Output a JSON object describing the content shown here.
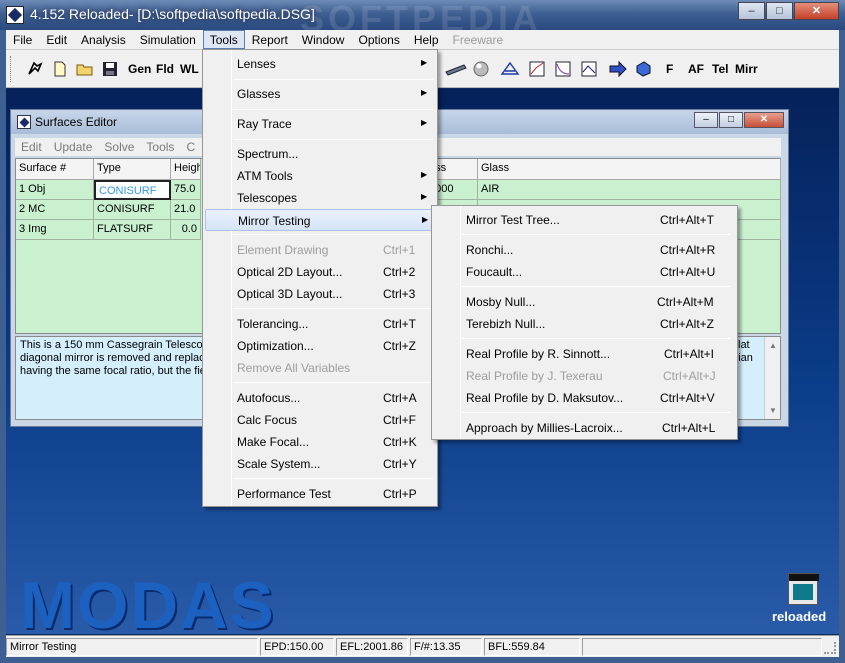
{
  "window": {
    "title": "4.152 Reloaded- [D:\\softpedia\\softpedia.DSG]",
    "watermark": "SOFTPEDIA",
    "minimize": "–",
    "maximize": "□",
    "close": "✕"
  },
  "menubar": [
    "File",
    "Edit",
    "Analysis",
    "Simulation",
    "Tools",
    "Report",
    "Window",
    "Options",
    "Help",
    "Freeware"
  ],
  "toolbar": {
    "text_buttons": [
      "Gen",
      "Fld",
      "WL",
      "F",
      "AF",
      "Tel",
      "Mirr"
    ],
    "icons": [
      "pointer-icon",
      "new-file-icon",
      "open-folder-icon",
      "save-icon",
      "lens-icon",
      "sphere-icon",
      "spot-diagram-icon",
      "mtf-chart-icon",
      "psf-chart-icon",
      "image-icon",
      "arrow-icon",
      "cube-icon"
    ]
  },
  "editor": {
    "title": "Surfaces Editor",
    "menu": [
      "Edit",
      "Update",
      "Solve",
      "Tools",
      "C"
    ],
    "columns": [
      "Surface #",
      "Type",
      "Heigh",
      "ess",
      "Glass"
    ],
    "rows": [
      {
        "surface": "1 Obj",
        "type": "CONISURF",
        "height": "75.0",
        "thickness": "0000",
        "glass": "AIR"
      },
      {
        "surface": "2 MC",
        "type": "CONISURF",
        "height": "21.0",
        "thickness": "",
        "glass": ""
      },
      {
        "surface": "3 Img",
        "type": "FLATSURF",
        "height": "0.0",
        "thickness": "",
        "glass": ""
      }
    ],
    "description": [
      "This is a 150 mm Cassegrain Telescop",
      "diagonal mirror is removed and replace",
      "having the same focal ratio, but the fie"
    ],
    "description_right": [
      "lat",
      "onian"
    ]
  },
  "tools_menu": {
    "items": [
      {
        "label": "Lenses",
        "shortcut": "",
        "submenu": true,
        "disabled": false
      },
      {
        "label": "Glasses",
        "shortcut": "",
        "submenu": true,
        "disabled": false
      },
      {
        "label": "Ray Trace",
        "shortcut": "",
        "submenu": true,
        "disabled": false
      },
      {
        "label": "Spectrum...",
        "shortcut": "",
        "submenu": false,
        "disabled": false
      },
      {
        "label": "ATM Tools",
        "shortcut": "",
        "submenu": true,
        "disabled": false
      },
      {
        "label": "Telescopes",
        "shortcut": "",
        "submenu": true,
        "disabled": false
      },
      {
        "label": "Mirror Testing",
        "shortcut": "",
        "submenu": true,
        "disabled": false
      },
      {
        "label": "Element Drawing",
        "shortcut": "Ctrl+1",
        "submenu": false,
        "disabled": true
      },
      {
        "label": "Optical 2D Layout...",
        "shortcut": "Ctrl+2",
        "submenu": false,
        "disabled": false
      },
      {
        "label": "Optical 3D Layout...",
        "shortcut": "Ctrl+3",
        "submenu": false,
        "disabled": false
      },
      {
        "label": "Tolerancing...",
        "shortcut": "Ctrl+T",
        "submenu": false,
        "disabled": false
      },
      {
        "label": "Optimization...",
        "shortcut": "Ctrl+Z",
        "submenu": false,
        "disabled": false
      },
      {
        "label": "Remove All Variables",
        "shortcut": "",
        "submenu": false,
        "disabled": true
      },
      {
        "label": "Autofocus...",
        "shortcut": "Ctrl+A",
        "submenu": false,
        "disabled": false
      },
      {
        "label": "Calc Focus",
        "shortcut": "Ctrl+F",
        "submenu": false,
        "disabled": false
      },
      {
        "label": "Make Focal...",
        "shortcut": "Ctrl+K",
        "submenu": false,
        "disabled": false
      },
      {
        "label": "Scale System...",
        "shortcut": "Ctrl+Y",
        "submenu": false,
        "disabled": false
      },
      {
        "label": "Performance Test",
        "shortcut": "Ctrl+P",
        "submenu": false,
        "disabled": false
      }
    ]
  },
  "mirror_menu": {
    "items": [
      {
        "label": "Mirror Test Tree...",
        "shortcut": "Ctrl+Alt+T",
        "disabled": false
      },
      {
        "label": "Ronchi...",
        "shortcut": "Ctrl+Alt+R",
        "disabled": false
      },
      {
        "label": "Foucault...",
        "shortcut": "Ctrl+Alt+U",
        "disabled": false
      },
      {
        "label": "Mosby Null...",
        "shortcut": "Ctrl+Alt+M",
        "disabled": false
      },
      {
        "label": "Terebizh Null...",
        "shortcut": "Ctrl+Alt+Z",
        "disabled": false
      },
      {
        "label": "Real Profile by R. Sinnott...",
        "shortcut": "Ctrl+Alt+I",
        "disabled": false
      },
      {
        "label": "Real Profile by J. Texerau",
        "shortcut": "Ctrl+Alt+J",
        "disabled": true
      },
      {
        "label": "Real Profile by D. Maksutov...",
        "shortcut": "Ctrl+Alt+V",
        "disabled": false
      },
      {
        "label": "Approach by Millies-Lacroix...",
        "shortcut": "Ctrl+Alt+L",
        "disabled": false
      }
    ]
  },
  "desktop": {
    "brand": "MODAS",
    "logo_text": "reloaded"
  },
  "statusbar": {
    "message": "Mirror Testing",
    "epd": "EPD:150.00",
    "efl": "EFL:2001.86",
    "fnum": "F/#:13.35",
    "bfl": "BFL:559.84"
  }
}
